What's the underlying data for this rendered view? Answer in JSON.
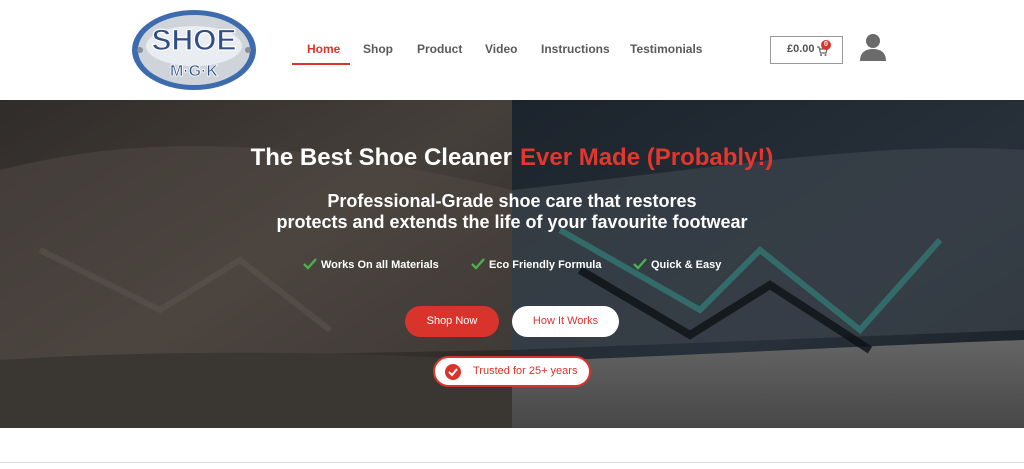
{
  "brand": {
    "logo_top": "SHOE",
    "logo_bottom": "M·G·K"
  },
  "nav": {
    "items": [
      {
        "label": "Home",
        "active": true
      },
      {
        "label": "Shop"
      },
      {
        "label": "Product"
      },
      {
        "label": "Video"
      },
      {
        "label": "Instructions"
      },
      {
        "label": "Testimonials"
      }
    ]
  },
  "cart": {
    "amount": "£0.00",
    "count": "0",
    "icon": "cart-icon"
  },
  "user": {
    "icon": "user-icon"
  },
  "hero": {
    "title": "The Best Shoe Cleaner",
    "title_accent": "Ever Made (Probably!)",
    "subtitle_line1": "Professional-Grade shoe care that restores",
    "subtitle_line2": "protects and extends the life of your favourite footwear",
    "features": [
      "Works On all Materials",
      "Eco Friendly Formula",
      "Quick & Easy"
    ],
    "primary_cta": "Shop Now",
    "secondary_cta": "How It Works",
    "trust_badge": "Trusted for 25+ years"
  },
  "colors": {
    "accent": "#d9342b",
    "nav_text": "#5a5a5a",
    "check": "#4caf50"
  }
}
